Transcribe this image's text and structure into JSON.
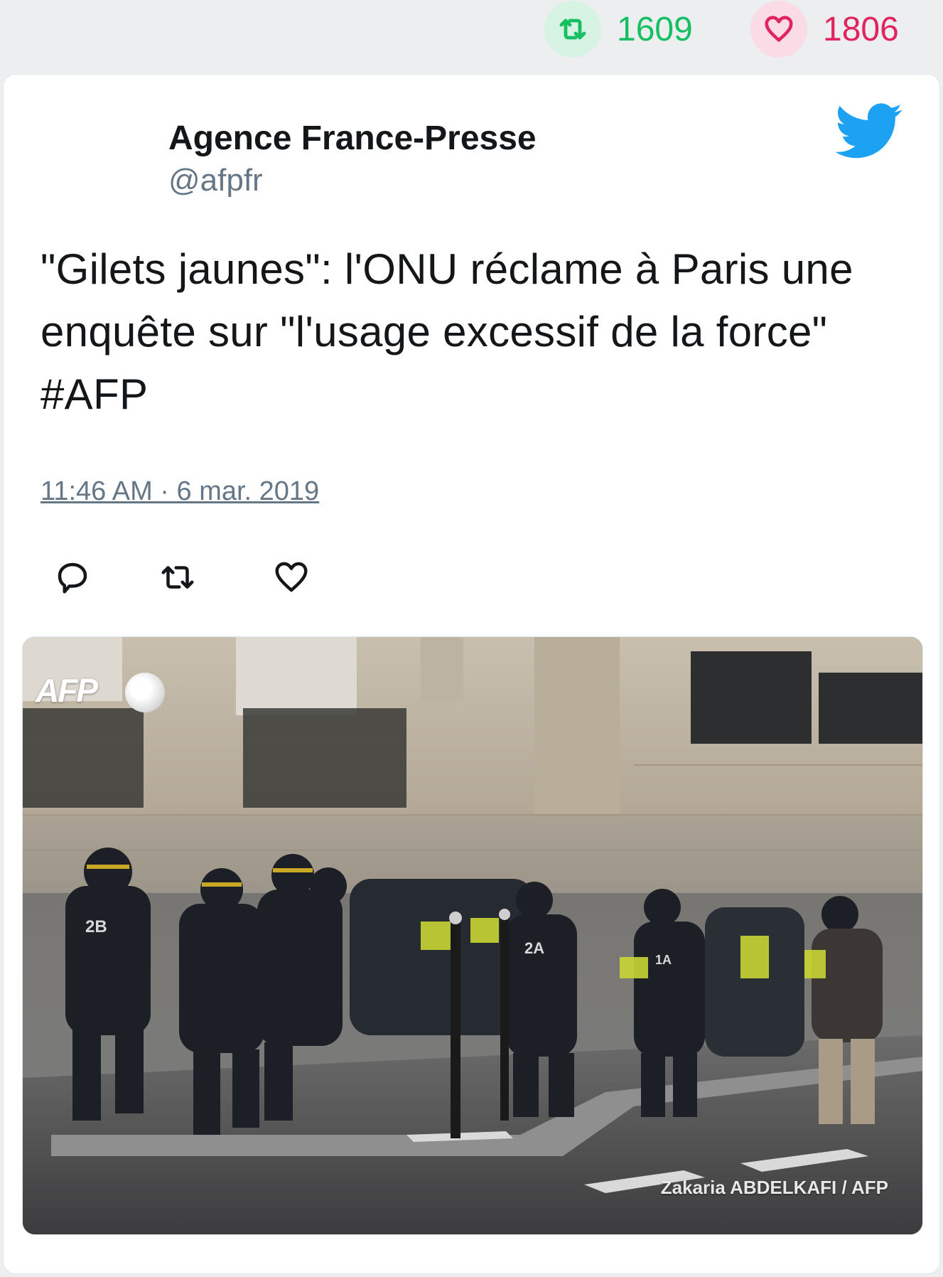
{
  "stats": {
    "retweets": "1609",
    "likes": "1806",
    "retweet_color": "#17bf63",
    "like_color": "#e0245e"
  },
  "tweet": {
    "author_name": "Agence France-Presse",
    "author_handle": "@afpfr",
    "text": "\"Gilets jaunes\": l'ONU réclame à Paris une enquête sur \"l'usage excessif de la force\" #AFP",
    "timestamp": "11:46 AM · 6 mar. 2019"
  },
  "photo": {
    "watermark": "AFP",
    "credit": "Zakaria ABDELKAFI / AFP"
  },
  "icons": {
    "brand": "twitter-bird-icon",
    "actions": [
      "reply-icon",
      "retweet-icon",
      "like-icon"
    ]
  },
  "colors": {
    "brand_blue": "#1da1f2",
    "text_primary": "#14171a",
    "text_secondary": "#657786"
  }
}
